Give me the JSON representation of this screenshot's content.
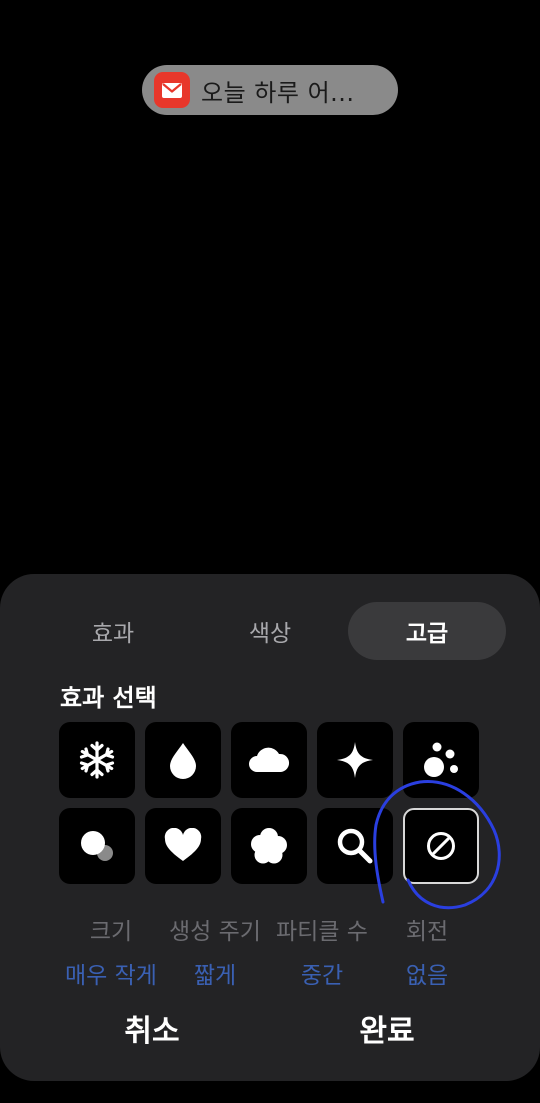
{
  "notification": {
    "text": "오늘 하루 어...",
    "icon": "mail-icon",
    "icon_color": "#e8372b"
  },
  "tabs": [
    {
      "label": "효과",
      "active": false
    },
    {
      "label": "색상",
      "active": false
    },
    {
      "label": "고급",
      "active": true
    }
  ],
  "section_title": "효과 선택",
  "effects": [
    {
      "icon": "snowflake-icon"
    },
    {
      "icon": "water-drop-icon"
    },
    {
      "icon": "cloud-icon"
    },
    {
      "icon": "sparkle-icon"
    },
    {
      "icon": "bubbles-icon"
    },
    {
      "icon": "circles-icon"
    },
    {
      "icon": "heart-icon"
    },
    {
      "icon": "flower-icon"
    },
    {
      "icon": "magnifier-icon"
    },
    {
      "icon": "none-icon",
      "selected": true
    }
  ],
  "properties": {
    "labels": [
      "크기",
      "생성 주기",
      "파티클 수",
      "회전"
    ],
    "values": [
      "매우 작게",
      "짧게",
      "중간",
      "없음"
    ]
  },
  "buttons": {
    "cancel": "취소",
    "done": "완료"
  },
  "colors": {
    "sheet_background": "#232325",
    "active_tab": "#3a3a3c",
    "value_text": "#3a60b3",
    "annotation_stroke": "#2a3fe0"
  }
}
